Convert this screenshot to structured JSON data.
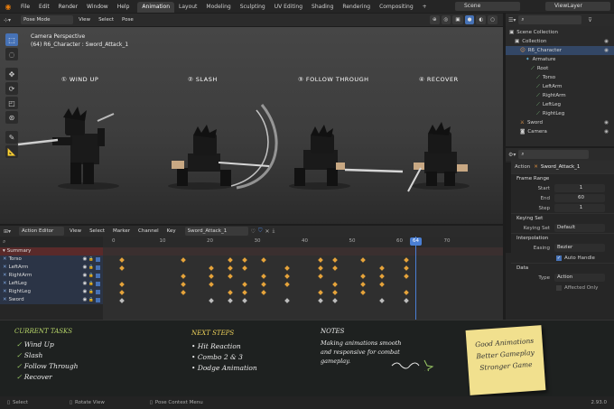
{
  "menu": [
    "File",
    "Edit",
    "Render",
    "Window",
    "Help"
  ],
  "workspace_tabs": [
    "Animation",
    "Layout",
    "Modeling",
    "Sculpting",
    "UV Editing",
    "Shading",
    "Rendering",
    "Compositing"
  ],
  "active_tab": "Animation",
  "add_tab": "+",
  "scene": "Scene",
  "view_layer": "ViewLayer",
  "viewport": {
    "mode": "Pose Mode",
    "menus": [
      "View",
      "Select",
      "Pose"
    ],
    "camera_label": "Camera Perspective",
    "object_label": "(64) R6_Character : Sword_Attack_1",
    "steps": [
      "① WIND UP",
      "② SLASH",
      "③ FOLLOW THROUGH",
      "④ RECOVER"
    ]
  },
  "outliner": {
    "rows": [
      {
        "label": "Scene Collection",
        "indent": 0,
        "icon": "box-icon"
      },
      {
        "label": "Collection",
        "indent": 1,
        "icon": "box-icon"
      },
      {
        "label": "R6_Character",
        "indent": 2,
        "icon": "person-icon"
      },
      {
        "label": "Armature",
        "indent": 3,
        "icon": "run-icon"
      },
      {
        "label": "Root",
        "indent": 4,
        "icon": "bone-icon"
      },
      {
        "label": "Torso",
        "indent": 5,
        "icon": "bone-icon"
      },
      {
        "label": "LeftArm",
        "indent": 5,
        "icon": "bone-icon"
      },
      {
        "label": "RightArm",
        "indent": 5,
        "icon": "bone-icon"
      },
      {
        "label": "LeftLeg",
        "indent": 5,
        "icon": "bone-icon"
      },
      {
        "label": "RightLeg",
        "indent": 5,
        "icon": "bone-icon"
      },
      {
        "label": "Sword",
        "indent": 2,
        "icon": "sword-icon"
      },
      {
        "label": "Camera",
        "indent": 2,
        "icon": "camera-icon"
      }
    ]
  },
  "properties": {
    "action_label": "Action",
    "action_name": "Sword_Attack_1",
    "frame_range": {
      "title": "Frame Range",
      "start_label": "Start",
      "start": "1",
      "end_label": "End",
      "end": "60",
      "step_label": "Step",
      "step": "1"
    },
    "keying": {
      "title": "Keying Set",
      "label": "Keying Set",
      "value": "Default"
    },
    "interpolation": {
      "title": "Interpolation",
      "easing_label": "Easing",
      "easing": "Bezier",
      "auto_handle": "Auto Handle"
    },
    "data": {
      "title": "Data",
      "type_label": "Type",
      "type": "Action",
      "affected_only": "Affected Only"
    }
  },
  "dopesheet": {
    "editor": "Action Editor",
    "menus": [
      "View",
      "Select",
      "Marker",
      "Channel",
      "Key"
    ],
    "action": "Sword_Attack_1",
    "summary": "Summary",
    "channels": [
      "Torso",
      "LeftArm",
      "RightArm",
      "LeftLeg",
      "RightLeg",
      "Sword"
    ],
    "frames": [
      "0",
      "10",
      "20",
      "30",
      "40",
      "50",
      "60",
      "64",
      "70"
    ],
    "current_frame": 64
  },
  "notes": {
    "tasks_title": "CURRENT TASKS",
    "tasks": [
      "Wind Up",
      "Slash",
      "Follow Through",
      "Recover"
    ],
    "next_title": "NEXT STEPS",
    "next": [
      "Hit Reaction",
      "Combo 2 & 3",
      "Dodge Animation"
    ],
    "notes_title": "NOTES",
    "notes_text": [
      "Making animations smooth",
      "and responsive for combat",
      "gameplay."
    ],
    "sticky": [
      "Good Animations",
      "Better Gameplay",
      "Stronger Game"
    ]
  },
  "status": {
    "select": "Select",
    "rotate": "Rotate View",
    "context": "Pose Context Menu",
    "version": "2.93.0"
  },
  "colors": {
    "accent": "#4672b6",
    "keyframe": "#e6a33a",
    "playhead": "#4a7fd4",
    "sticky": "#f1e08e"
  }
}
